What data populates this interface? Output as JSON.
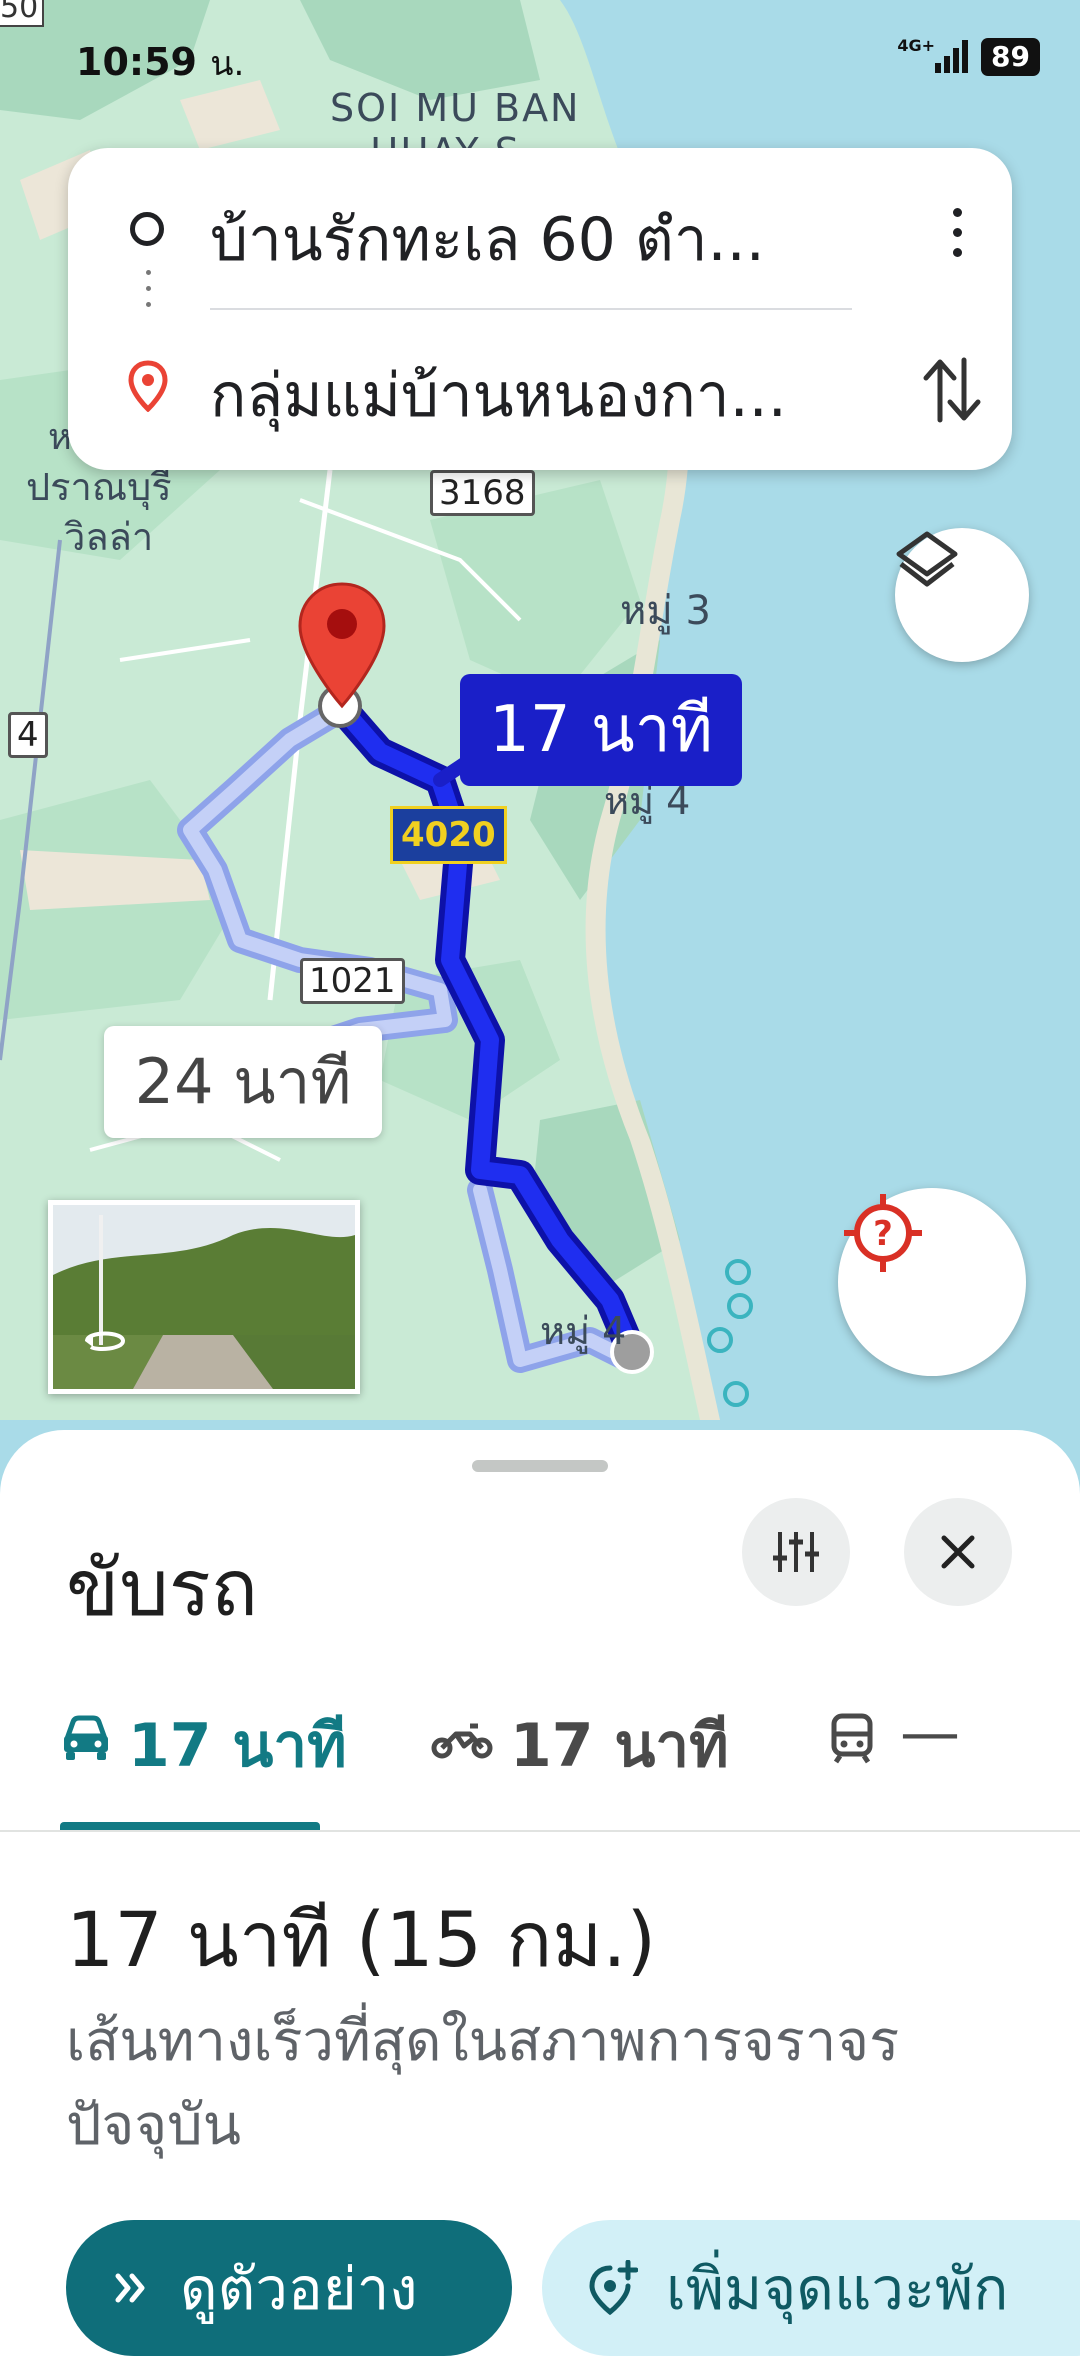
{
  "status_bar": {
    "time": "10:59",
    "time_suffix": "น.",
    "network": "4G+",
    "battery": "89"
  },
  "map": {
    "labels": {
      "soi": "SOI MU BAN",
      "soi_partial": "HUAY S",
      "village_1": "ปราณบุรี",
      "village_2": "วิลล่า",
      "village_prefix": "ห",
      "moo_3": "หมู่ 3",
      "moo_4a": "หมู่ 4",
      "moo_4b": "หมู่ 4",
      "road_3168": "3168",
      "road_4020": "4020",
      "road_1021": "1021",
      "road_4": "4",
      "edge_50": "50"
    },
    "route_main_label": "17 นาที",
    "route_alt_label": "24 นาที",
    "colors": {
      "route_main": "#1a1fc8",
      "route_alt": "#9aacf0",
      "water": "#a9dbe8",
      "land": "#c9ead5",
      "pin": "#ea4335"
    }
  },
  "route_card": {
    "origin": "บ้านรักทะเล 60 ตำ...",
    "destination": "กลุ่มแม่บ้านหนองกา..."
  },
  "sheet": {
    "title": "ขับรถ",
    "tabs": [
      {
        "mode": "car-icon",
        "label": "17 นาที",
        "selected": true
      },
      {
        "mode": "motorcycle-icon",
        "label": "17 นาที",
        "selected": false
      },
      {
        "mode": "train-icon",
        "label": "—",
        "selected": false
      }
    ],
    "summary": "17 นาที (15 กม.)",
    "description": "เส้นทางเร็วที่สุดในสภาพการจราจรปัจจุบัน",
    "preview_button": "ดูตัวอย่าง",
    "add_stop_button": "เพิ่มจุดแวะพัก",
    "accent": "#0f6e7a"
  }
}
